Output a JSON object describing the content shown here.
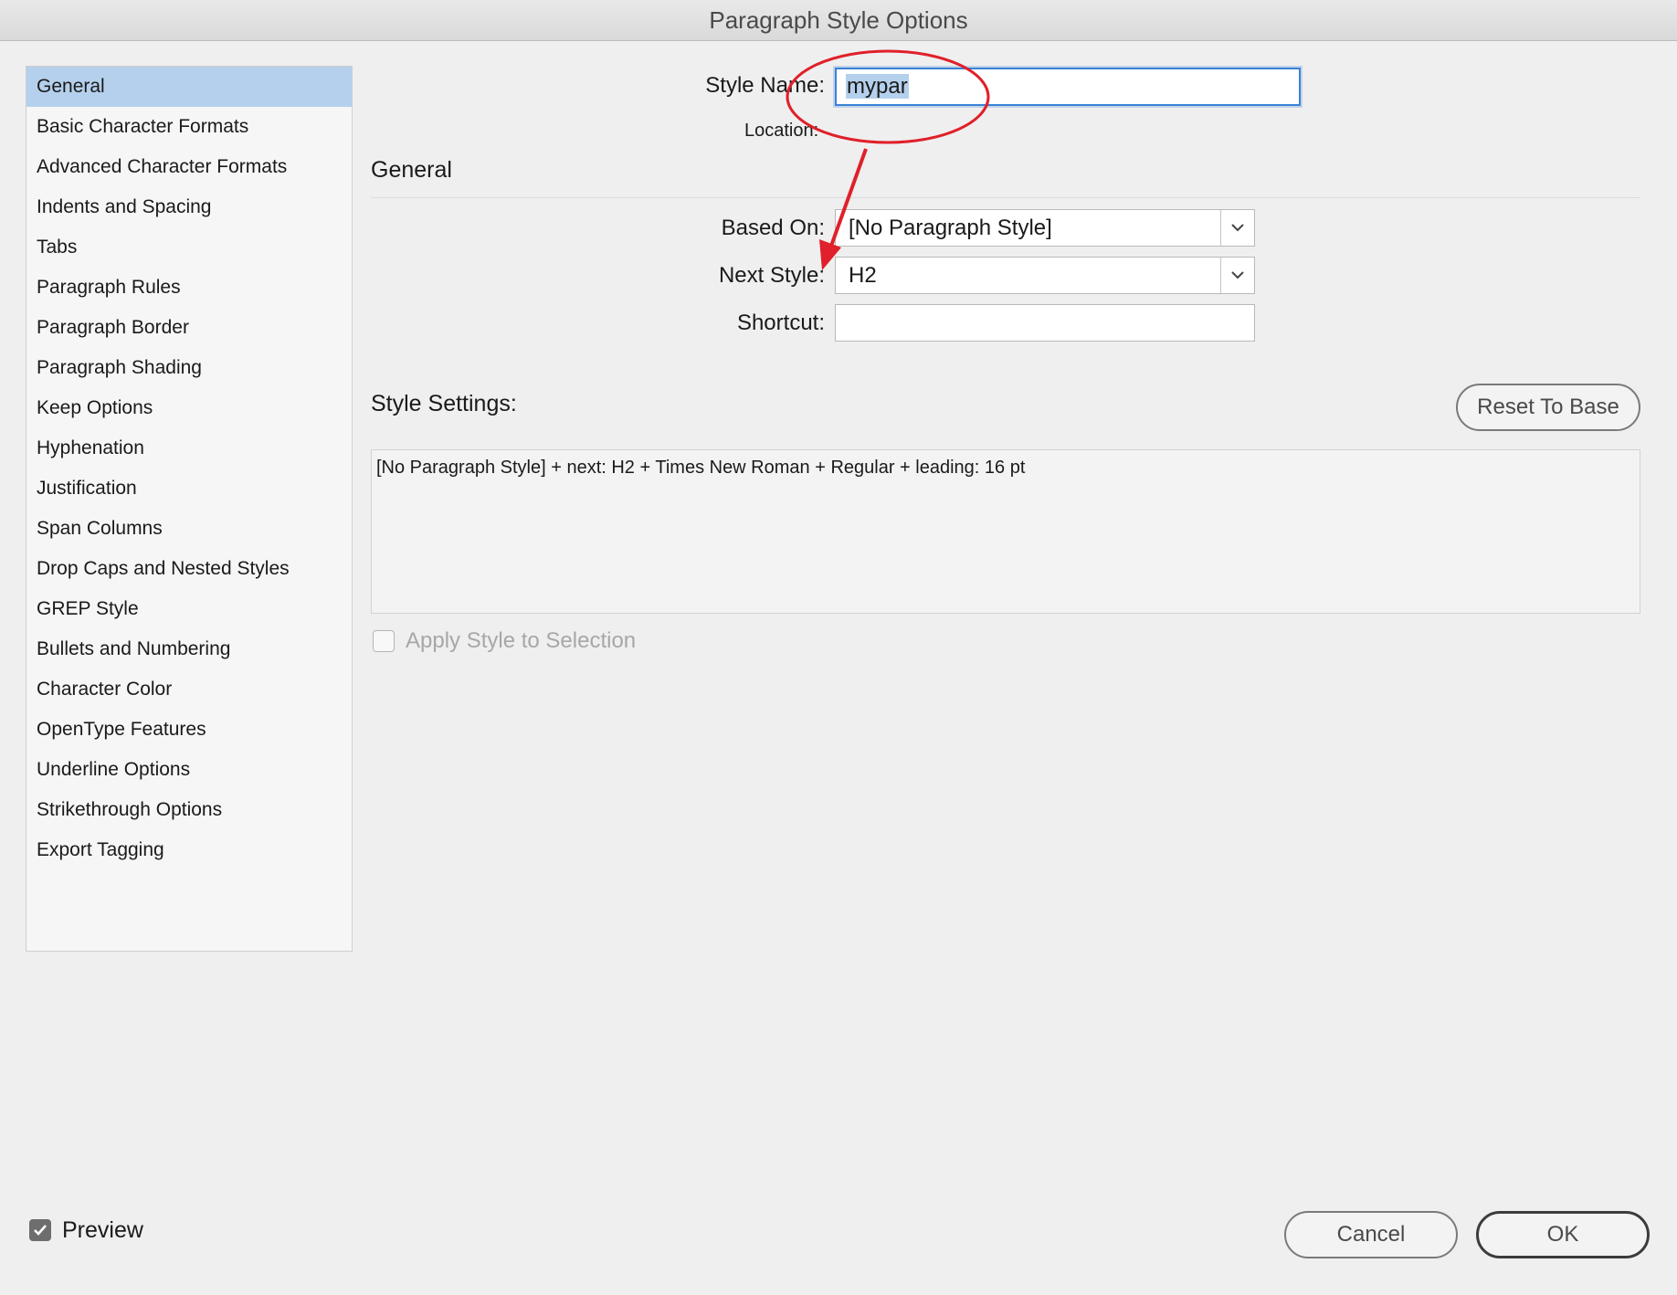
{
  "window": {
    "title": "Paragraph Style Options"
  },
  "sidebar": {
    "items": [
      {
        "label": "General"
      },
      {
        "label": "Basic Character Formats"
      },
      {
        "label": "Advanced Character Formats"
      },
      {
        "label": "Indents and Spacing"
      },
      {
        "label": "Tabs"
      },
      {
        "label": "Paragraph Rules"
      },
      {
        "label": "Paragraph Border"
      },
      {
        "label": "Paragraph Shading"
      },
      {
        "label": "Keep Options"
      },
      {
        "label": "Hyphenation"
      },
      {
        "label": "Justification"
      },
      {
        "label": "Span Columns"
      },
      {
        "label": "Drop Caps and Nested Styles"
      },
      {
        "label": "GREP Style"
      },
      {
        "label": "Bullets and Numbering"
      },
      {
        "label": "Character Color"
      },
      {
        "label": "OpenType Features"
      },
      {
        "label": "Underline Options"
      },
      {
        "label": "Strikethrough Options"
      },
      {
        "label": "Export Tagging"
      }
    ],
    "selected": "General"
  },
  "form": {
    "style_name_label": "Style Name:",
    "style_name_value": "mypar",
    "location_label": "Location:",
    "section_title": "General",
    "based_on_label": "Based On:",
    "based_on_value": "[No Paragraph Style]",
    "next_style_label": "Next Style:",
    "next_style_value": "H2",
    "shortcut_label": "Shortcut:",
    "shortcut_value": "",
    "style_settings_label": "Style Settings:",
    "reset_button": "Reset To Base",
    "style_settings_text": "[No Paragraph Style] + next: H2 + Times New Roman + Regular + leading: 16 pt",
    "apply_label": "Apply Style to Selection"
  },
  "footer": {
    "preview_label": "Preview",
    "preview_checked": true,
    "cancel_button": "Cancel",
    "ok_button": "OK"
  },
  "colors": {
    "selection": "#b5d0ec",
    "focus": "#3b82d6",
    "annotation": "#e0202a"
  }
}
